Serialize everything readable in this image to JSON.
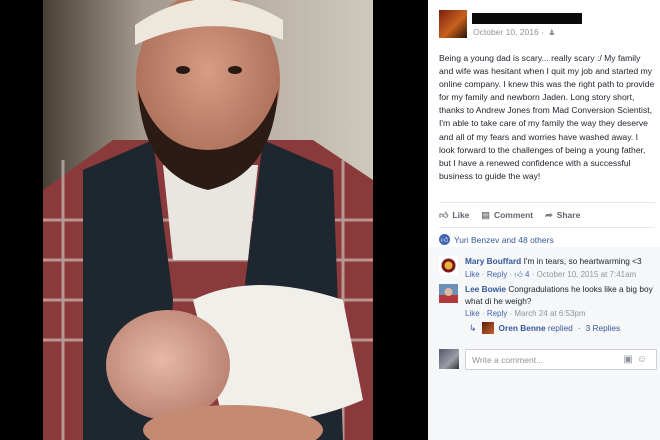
{
  "post": {
    "timestamp": "October 10, 2016",
    "audience_icon": "friends-icon",
    "text": "Being a young dad is scary... really scary :/ My family and wife was hesitant when I quit my job and started my online company. I knew this was the right path to provide for my family and newborn Jaden. Long story short, thanks to Andrew Jones from Mad Conversion Scientist, I'm able to take care of my family the way they deserve and all of my fears and worries have washed away. I look forward to the challenges of being a young father, but I have a renewed confidence with a successful business to guide the way!"
  },
  "actions": {
    "like": "Like",
    "comment": "Comment",
    "share": "Share"
  },
  "reactions": {
    "summary": "Yuri Benzev and 48 others"
  },
  "comments": [
    {
      "name": "Mary Bouffard",
      "text": "I'm in tears, so heartwarming <3",
      "like": "Like",
      "reply": "Reply",
      "likes": "4",
      "time": "October 10, 2015 at 7:41am"
    },
    {
      "name": "Lee Bowie",
      "text": "Congradulations he looks like a big boy what di he weigh?",
      "like": "Like",
      "reply": "Reply",
      "time": "March 24 at 6:53pm"
    }
  ],
  "reply_summary": {
    "name": "Oren Benne",
    "action": "replied",
    "count": "3 Replies"
  },
  "composer": {
    "placeholder": "Write a comment..."
  },
  "colors": {
    "link": "#365899",
    "accent": "#4267b2",
    "muted": "#90949c"
  }
}
